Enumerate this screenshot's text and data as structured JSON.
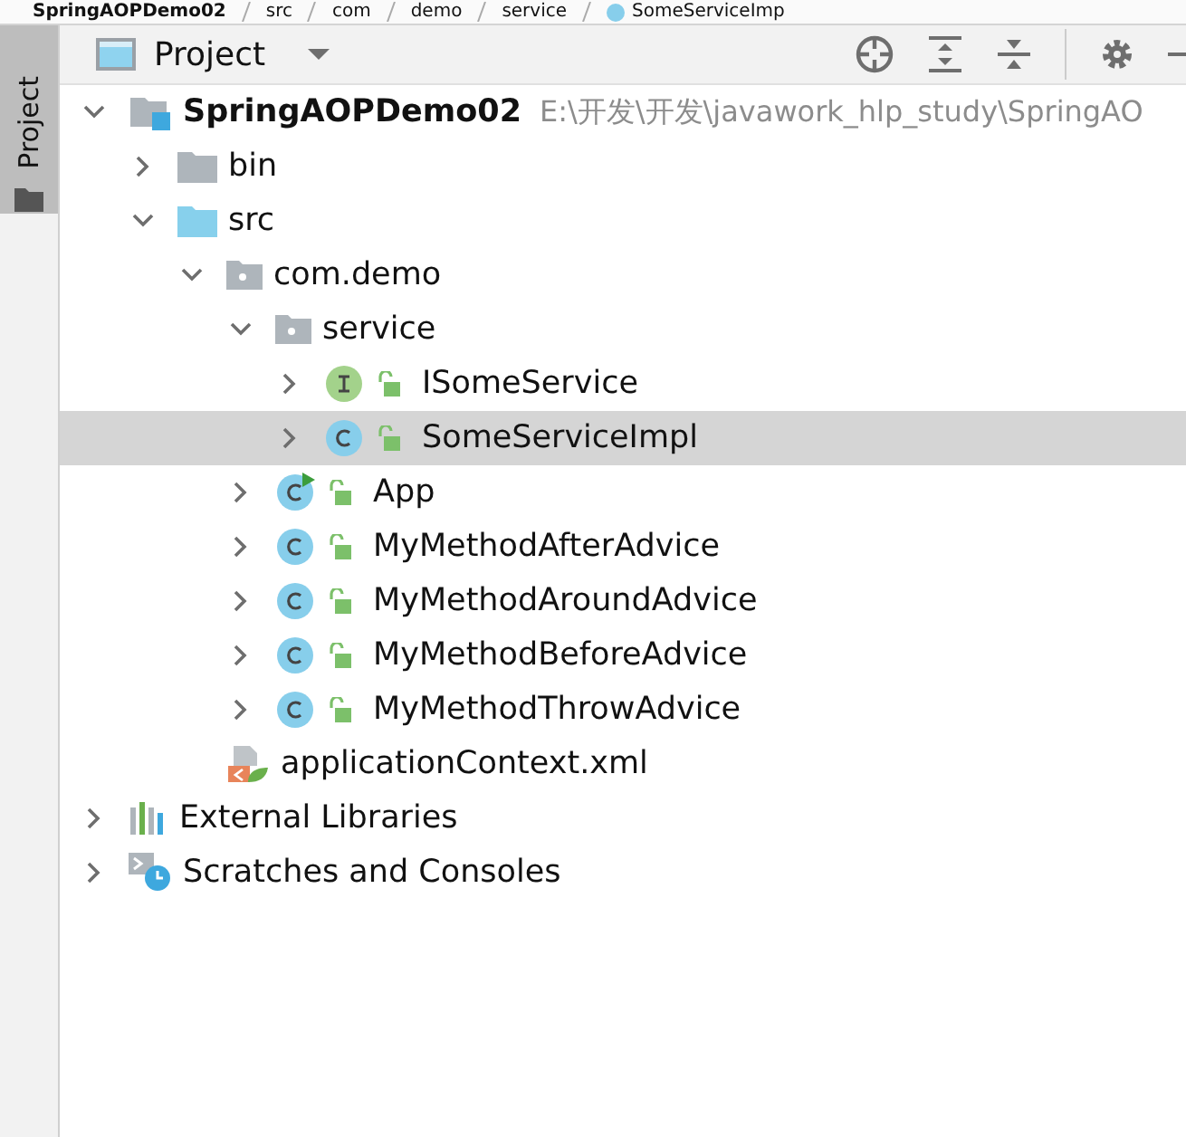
{
  "breadcrumbs": [
    "SpringAOPDemo02",
    "src",
    "com",
    "demo",
    "service",
    "SomeServiceImp"
  ],
  "side_tab": {
    "label": "Project",
    "selected": true
  },
  "toolbar": {
    "view": "Project"
  },
  "tree": [
    {
      "kind": "module",
      "label": "SpringAOPDemo02",
      "path": "E:\\开发\\开发\\javawork_hlp_study\\SpringAO",
      "expanded": true,
      "selected": false,
      "children": [
        {
          "kind": "folder",
          "label": "bin",
          "expanded": false,
          "selected": false
        },
        {
          "kind": "source_folder",
          "label": "src",
          "expanded": true,
          "selected": false,
          "children": [
            {
              "kind": "package",
              "label": "com.demo",
              "expanded": true,
              "selected": false,
              "children": [
                {
                  "kind": "package",
                  "label": "service",
                  "expanded": true,
                  "selected": false,
                  "children": [
                    {
                      "kind": "interface",
                      "label": "ISomeService",
                      "expanded": false,
                      "selected": false
                    },
                    {
                      "kind": "class",
                      "label": "SomeServiceImpl",
                      "expanded": false,
                      "selected": true
                    }
                  ]
                },
                {
                  "kind": "main_class",
                  "label": "App",
                  "expanded": false,
                  "selected": false
                },
                {
                  "kind": "class",
                  "label": "MyMethodAfterAdvice",
                  "expanded": false,
                  "selected": false
                },
                {
                  "kind": "class",
                  "label": "MyMethodAroundAdvice",
                  "expanded": false,
                  "selected": false
                },
                {
                  "kind": "class",
                  "label": "MyMethodBeforeAdvice",
                  "expanded": false,
                  "selected": false
                },
                {
                  "kind": "class",
                  "label": "MyMethodThrowAdvice",
                  "expanded": false,
                  "selected": false
                }
              ]
            },
            {
              "kind": "xml",
              "label": "applicationContext.xml",
              "selected": false
            }
          ]
        }
      ]
    },
    {
      "kind": "libraries",
      "label": "External Libraries",
      "expanded": false,
      "selected": false
    },
    {
      "kind": "scratches",
      "label": "Scratches and Consoles",
      "expanded": false,
      "selected": false
    }
  ]
}
